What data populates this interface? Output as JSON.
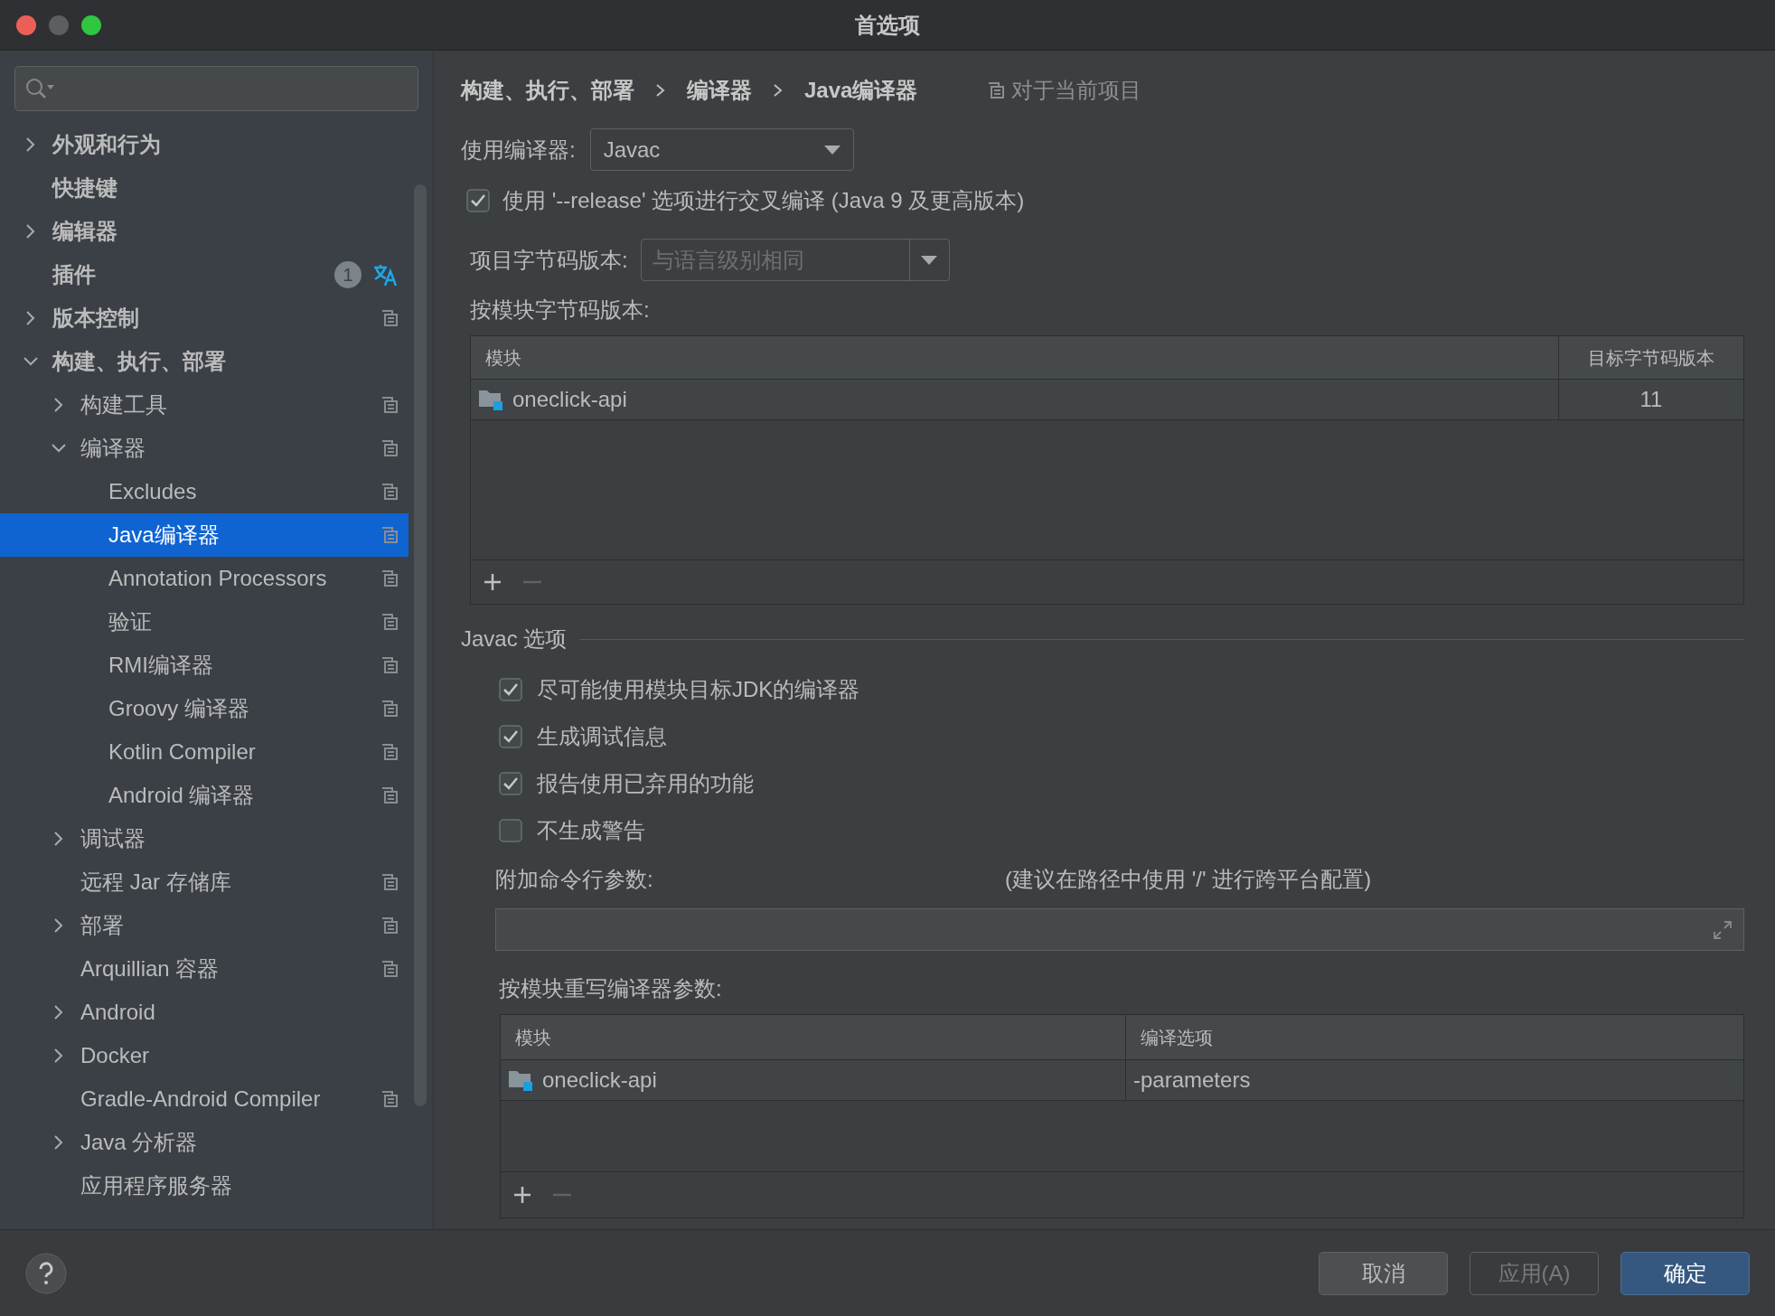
{
  "window": {
    "title": "首选项"
  },
  "sidebar": {
    "items": [
      {
        "label": "外观和行为",
        "kind": "group",
        "expanded": false,
        "selected": false,
        "project_scoped": false
      },
      {
        "label": "快捷键",
        "kind": "leaf",
        "selected": false,
        "project_scoped": false
      },
      {
        "label": "编辑器",
        "kind": "group",
        "expanded": false,
        "selected": false,
        "project_scoped": false
      },
      {
        "label": "插件",
        "kind": "leaf",
        "selected": false,
        "project_scoped": false,
        "badge": "1"
      },
      {
        "label": "版本控制",
        "kind": "group",
        "expanded": false,
        "selected": false,
        "project_scoped": true
      },
      {
        "label": "构建、执行、部署",
        "kind": "group",
        "expanded": true,
        "selected": false,
        "project_scoped": false,
        "children": [
          {
            "label": "构建工具",
            "kind": "group",
            "expanded": false,
            "selected": false,
            "project_scoped": true
          },
          {
            "label": "编译器",
            "kind": "group",
            "expanded": true,
            "selected": false,
            "project_scoped": true,
            "children": [
              {
                "label": "Excludes",
                "kind": "leaf",
                "selected": false,
                "project_scoped": true
              },
              {
                "label": "Java编译器",
                "kind": "leaf",
                "selected": true,
                "project_scoped": true
              },
              {
                "label": "Annotation Processors",
                "kind": "leaf",
                "selected": false,
                "project_scoped": true
              },
              {
                "label": "验证",
                "kind": "leaf",
                "selected": false,
                "project_scoped": true
              },
              {
                "label": "RMI编译器",
                "kind": "leaf",
                "selected": false,
                "project_scoped": true
              },
              {
                "label": "Groovy 编译器",
                "kind": "leaf",
                "selected": false,
                "project_scoped": true
              },
              {
                "label": "Kotlin Compiler",
                "kind": "leaf",
                "selected": false,
                "project_scoped": true
              },
              {
                "label": "Android 编译器",
                "kind": "leaf",
                "selected": false,
                "project_scoped": true
              }
            ]
          },
          {
            "label": "调试器",
            "kind": "group",
            "expanded": false,
            "selected": false,
            "project_scoped": false
          },
          {
            "label": "远程 Jar 存储库",
            "kind": "leaf",
            "selected": false,
            "project_scoped": true
          },
          {
            "label": "部署",
            "kind": "group",
            "expanded": false,
            "selected": false,
            "project_scoped": true
          },
          {
            "label": "Arquillian 容器",
            "kind": "leaf",
            "selected": false,
            "project_scoped": true
          },
          {
            "label": "Android",
            "kind": "group",
            "expanded": false,
            "selected": false,
            "project_scoped": false
          },
          {
            "label": "Docker",
            "kind": "group",
            "expanded": false,
            "selected": false,
            "project_scoped": false
          },
          {
            "label": "Gradle-Android Compiler",
            "kind": "leaf",
            "selected": false,
            "project_scoped": true
          },
          {
            "label": "Java 分析器",
            "kind": "group",
            "expanded": false,
            "selected": false,
            "project_scoped": false
          },
          {
            "label": "应用程序服务器",
            "kind": "leaf",
            "selected": false,
            "project_scoped": false
          }
        ]
      }
    ]
  },
  "breadcrumb": [
    "构建、执行、部署",
    "编译器",
    "Java编译器"
  ],
  "scope_note": "对于当前项目",
  "compiler": {
    "label": "使用编译器:",
    "value": "Javac"
  },
  "release_option": {
    "label": "使用 '--release' 选项进行交叉编译 (Java 9 及更高版本)",
    "checked": true
  },
  "project_bytecode": {
    "label": "项目字节码版本:",
    "placeholder": "与语言级别相同",
    "disabled": true
  },
  "module_bytecode": {
    "label": "按模块字节码版本:",
    "columns": [
      "模块",
      "目标字节码版本"
    ],
    "rows": [
      {
        "module": "oneclick-api",
        "version": "11"
      }
    ]
  },
  "javac": {
    "title": "Javac 选项",
    "options": [
      {
        "label": "尽可能使用模块目标JDK的编译器",
        "checked": true
      },
      {
        "label": "生成调试信息",
        "checked": true
      },
      {
        "label": "报告使用已弃用的功能",
        "checked": true
      },
      {
        "label": "不生成警告",
        "checked": false
      }
    ],
    "extra_args": {
      "label": "附加命令行参数:",
      "hint": "(建议在路径中使用 '/' 进行跨平台配置)"
    },
    "override": {
      "label": "按模块重写编译器参数:",
      "columns": [
        "模块",
        "编译选项"
      ],
      "rows": [
        {
          "module": "oneclick-api",
          "options": "-parameters"
        }
      ]
    }
  },
  "buttons": [
    {
      "label": "取消",
      "kind": "default",
      "disabled": false
    },
    {
      "label": "应用(A)",
      "kind": "default",
      "disabled": true
    },
    {
      "label": "确定",
      "kind": "primary",
      "disabled": false
    }
  ]
}
